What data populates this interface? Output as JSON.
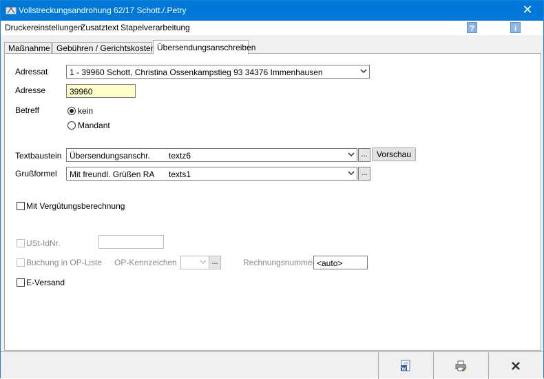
{
  "window": {
    "title": "Vollstreckungsandrohung  62/17 Schott./.Petry",
    "close_glyph": "✕",
    "icon": "app-scale-icon"
  },
  "menu": [
    "Druckereinstellungen",
    "Zusatztext",
    "Stapelverarbeitung"
  ],
  "help": {
    "question": "?",
    "info": "i"
  },
  "tabs": [
    "Maßnahme",
    "Gebühren / Gerichtskosten",
    "Übersendungsanschreiben"
  ],
  "form": {
    "adressat_label": "Adressat",
    "adressat_value": "1 - 39960 Schott, Christina  Ossenkampstieg 93 34376 Immenhausen",
    "adresse_label": "Adresse",
    "adresse_value": "39960",
    "betreff_label": "Betreff",
    "radio_kein": "kein",
    "radio_mandant": "Mandant",
    "betreff_selected": "kein",
    "textbaustein_label": "Textbaustein",
    "textbaustein_name": "Übersendungsanschr.",
    "textbaustein_code": "textz6",
    "ellipsis": "...",
    "vorschau": "Vorschau",
    "grussformel_label": "Grußformel",
    "grussformel_name": "Mit freundl. Grüßen RA",
    "grussformel_code": "texts1",
    "verguetung_label": "Mit Vergütungsberechnung",
    "ustid_label": "USt-IdNr.",
    "buchung_label": "Buchung in OP-Liste",
    "opkennzeichen_label": "OP-Kennzeichen",
    "rechnungsnummer_label": "Rechnungsnummer",
    "rechnungsnummer_value": "<auto>",
    "eversand_label": "E-Versand"
  },
  "colors": {
    "titlebar": "#0078d7",
    "address_bg": "#ffffcc"
  },
  "footer_buttons": [
    "word-document-icon",
    "printer-icon",
    "close-x-icon"
  ]
}
